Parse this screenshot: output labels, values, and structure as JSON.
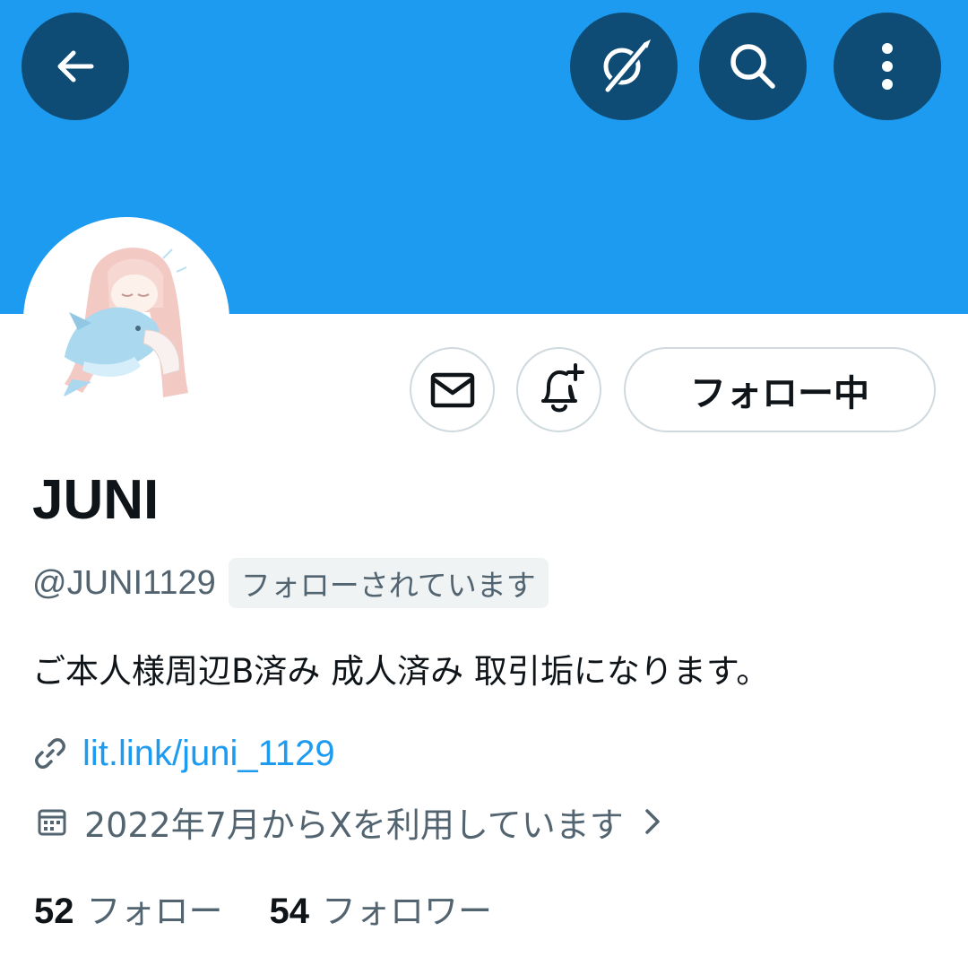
{
  "header": {
    "back_icon": "arrow-left-icon",
    "grok_icon": "grok-icon",
    "search_icon": "search-icon",
    "more_icon": "more-vertical-icon",
    "banner_color": "#1d9bf0",
    "button_color": "#0f4c75"
  },
  "profile": {
    "avatar_icon": "avatar-illustration",
    "display_name": "JUNI",
    "handle": "@JUNI1129",
    "follows_you": "フォローされています",
    "bio": "ご本人様周辺B済み 成人済み 取引垢になります。",
    "link": "lit.link/juni_1129",
    "joined": "2022年7月からXを利用しています"
  },
  "actions": {
    "message_icon": "mail-icon",
    "notify_icon": "bell-plus-icon",
    "follow_label": "フォロー中"
  },
  "stats": {
    "following_count": "52",
    "following_label": "フォロー",
    "followers_count": "54",
    "followers_label": "フォロワー"
  },
  "colors": {
    "accent": "#1d9bf0",
    "text": "#0f1419",
    "secondary": "#536471"
  }
}
